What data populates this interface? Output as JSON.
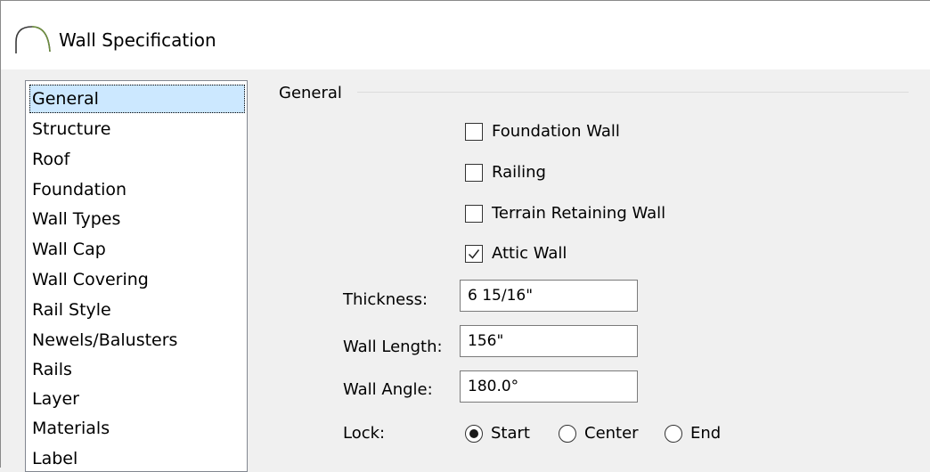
{
  "window": {
    "title": "Wall Specification",
    "icon": "arch-wall-icon"
  },
  "nav": {
    "items": [
      {
        "label": "General",
        "selected": true
      },
      {
        "label": "Structure"
      },
      {
        "label": "Roof"
      },
      {
        "label": "Foundation"
      },
      {
        "label": "Wall Types"
      },
      {
        "label": "Wall Cap"
      },
      {
        "label": "Wall Covering"
      },
      {
        "label": "Rail Style"
      },
      {
        "label": "Newels/Balusters"
      },
      {
        "label": "Rails"
      },
      {
        "label": "Layer"
      },
      {
        "label": "Materials"
      },
      {
        "label": "Label"
      }
    ]
  },
  "general": {
    "group_title": "General",
    "checkboxes": [
      {
        "label": "Foundation Wall",
        "checked": false
      },
      {
        "label": "Railing",
        "checked": false
      },
      {
        "label": "Terrain Retaining Wall",
        "checked": false
      },
      {
        "label": "Attic Wall",
        "checked": true
      }
    ],
    "thickness": {
      "label": "Thickness:",
      "value": "6 15/16\""
    },
    "wall_length": {
      "label": "Wall Length:",
      "value": "156\""
    },
    "wall_angle": {
      "label": "Wall Angle:",
      "value": "180.0°"
    },
    "lock": {
      "label": "Lock:",
      "options": [
        {
          "label": "Start",
          "selected": true
        },
        {
          "label": "Center",
          "selected": false
        },
        {
          "label": "End",
          "selected": false
        }
      ]
    }
  },
  "colors": {
    "selection": "#cce8ff",
    "title_bar": "#ffffff",
    "background": "#f0f0f0"
  }
}
